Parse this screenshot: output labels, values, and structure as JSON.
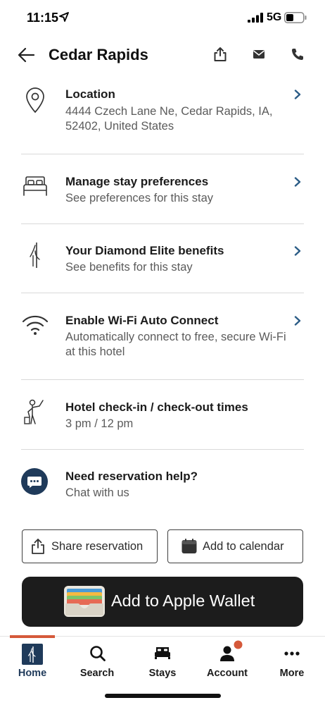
{
  "status_bar": {
    "time": "11:15",
    "network": "5G"
  },
  "header": {
    "title": "Cedar Rapids"
  },
  "rows": [
    {
      "title": "Location",
      "subtitle": "4444 Czech Lane Ne, Cedar Rapids, IA, 52402, United States",
      "icon": "map-pin-icon",
      "has_chevron": true
    },
    {
      "title": "Manage stay preferences",
      "subtitle": "See preferences for this stay",
      "icon": "bed-icon",
      "has_chevron": true
    },
    {
      "title": "Your Diamond Elite benefits",
      "subtitle": "See benefits for this stay",
      "icon": "waldorf-logo-icon",
      "has_chevron": true
    },
    {
      "title": "Enable Wi-Fi Auto Connect",
      "subtitle": "Automatically connect to free, secure Wi-Fi at this hotel",
      "icon": "wifi-icon",
      "has_chevron": true
    },
    {
      "title": "Hotel check-in / check-out times",
      "subtitle": "3 pm / 12 pm",
      "icon": "bellhop-icon",
      "has_chevron": false
    },
    {
      "title": "Need reservation help?",
      "subtitle": "Chat with us",
      "icon": "chat-icon",
      "has_chevron": false
    }
  ],
  "actions": {
    "share": "Share reservation",
    "calendar": "Add to calendar",
    "wallet": "Add to Apple Wallet"
  },
  "tabs": [
    {
      "label": "Home",
      "icon": "home-icon",
      "active": true
    },
    {
      "label": "Search",
      "icon": "search-icon",
      "active": false
    },
    {
      "label": "Stays",
      "icon": "stays-bed-icon",
      "active": false
    },
    {
      "label": "Account",
      "icon": "account-icon",
      "active": false,
      "badge": true
    },
    {
      "label": "More",
      "icon": "more-icon",
      "active": false
    }
  ],
  "colors": {
    "accent": "#d5593a",
    "navy": "#1f3a5a",
    "chevron": "#2b5c86",
    "wallet_bg": "#1c1c1c"
  }
}
